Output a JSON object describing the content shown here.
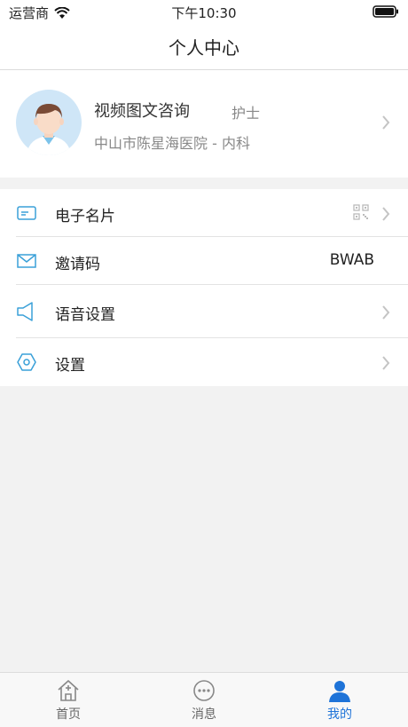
{
  "status": {
    "carrier": "运营商",
    "time": "下午10:30"
  },
  "nav": {
    "title": "个人中心"
  },
  "profile": {
    "name": "视频图文咨询",
    "role": "护士",
    "hospital": "中山市陈星海医院 - 内科"
  },
  "menu": {
    "items": [
      {
        "label": "电子名片",
        "icon": "card-icon"
      },
      {
        "label": "邀请码",
        "value": "BWAB",
        "icon": "envelope-icon"
      },
      {
        "label": "语音设置",
        "icon": "speaker-icon"
      },
      {
        "label": "设置",
        "icon": "gear-hex-icon"
      }
    ]
  },
  "tabs": [
    {
      "label": "首页",
      "icon": "home-icon"
    },
    {
      "label": "消息",
      "icon": "chat-icon"
    },
    {
      "label": "我的",
      "icon": "user-icon",
      "active": true
    }
  ],
  "colors": {
    "accent": "#1e73d8",
    "icon_blue": "#3aa0d8"
  }
}
